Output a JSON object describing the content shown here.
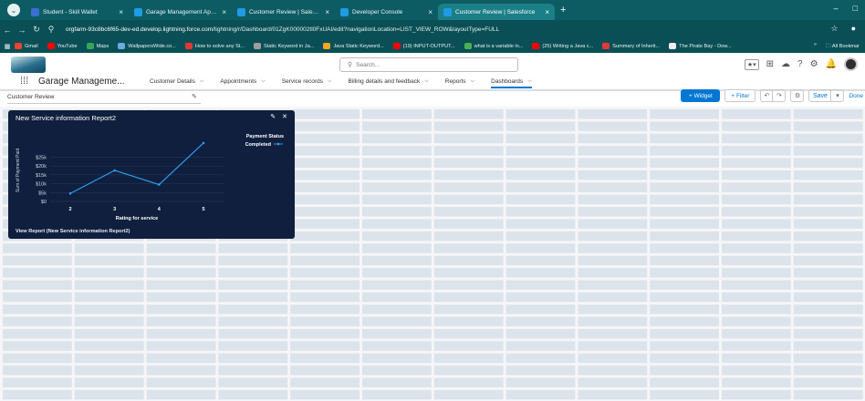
{
  "browser": {
    "tabs": [
      {
        "label": "Student - Skill Wallet",
        "color": "#3b6fd1"
      },
      {
        "label": "Garage Management Applicati",
        "color": "#1f9be6"
      },
      {
        "label": "Customer Review | Salesforce",
        "color": "#1f9be6"
      },
      {
        "label": "Developer Console",
        "color": "#1f9be6"
      },
      {
        "label": "Customer Review | Salesforce",
        "color": "#1f9be6",
        "active": true
      }
    ],
    "new_tab": "+",
    "url_host": "orgfarm-93c8bc6f65-dev-ed.develop.lightning.force.com",
    "url_path": "/lightning/r/Dashboard/01ZgK000002tl0FxUAI/edit?navigationLocation=LIST_VIEW_ROW&layoutType=FULL",
    "bookmarks": [
      {
        "label": "Gmail",
        "color": "#ea4335"
      },
      {
        "label": "YouTube",
        "color": "#ff0000"
      },
      {
        "label": "Maps",
        "color": "#34a853"
      },
      {
        "label": "WallpapersWide.co...",
        "color": "#6fa8dc"
      },
      {
        "label": "How to solve any St...",
        "color": "#e53935"
      },
      {
        "label": "Static Keyword in Ja...",
        "color": "#9e9e9e"
      },
      {
        "label": "Java Static Keyword...",
        "color": "#f5a623"
      },
      {
        "label": "(19) INPUT-OUTPUT...",
        "color": "#ff0000"
      },
      {
        "label": "what is a variable in...",
        "color": "#4caf50"
      },
      {
        "label": "(25) Writing a Java c...",
        "color": "#ff0000"
      },
      {
        "label": "Summary of Inherit...",
        "color": "#e53935"
      },
      {
        "label": "The Pirate Bay - Dow...",
        "color": "#eeeeee"
      }
    ],
    "bookmarks_more": "»",
    "all_bookmarks": "All Bookmar"
  },
  "salesforce": {
    "search_placeholder": "Search...",
    "app_name": "Garage Manageme...",
    "nav": [
      {
        "label": "Customer Details",
        "active": false
      },
      {
        "label": "Appointments",
        "active": false
      },
      {
        "label": "Service records",
        "active": false
      },
      {
        "label": "Billing details and feedback",
        "active": false
      },
      {
        "label": "Reports",
        "active": false
      },
      {
        "label": "Dashboards",
        "active": true
      }
    ]
  },
  "builder": {
    "dashboard_name": "Customer Review",
    "widget_button": "+ Widget",
    "filter_button": "+ Filter",
    "save_button": "Save",
    "done_button": "Done"
  },
  "widget": {
    "title": "New Service information Report2",
    "footer": "View Report (New Service information Report2)"
  },
  "chart_data": {
    "type": "line",
    "title": "New Service information Report2",
    "xlabel": "Rating for service",
    "ylabel": "Sum of Payment Paid",
    "categories": [
      "2",
      "3",
      "4",
      "5"
    ],
    "series": [
      {
        "name": "Completed",
        "values": [
          4.5,
          17.5,
          9.5,
          33
        ]
      }
    ],
    "legend_title": "Payment Status",
    "y_ticks": [
      "$0",
      "$5k",
      "$10k",
      "$15k",
      "$20k",
      "$25k"
    ],
    "ylim": [
      0,
      35
    ],
    "legend_position": "top-right",
    "grid": true
  }
}
